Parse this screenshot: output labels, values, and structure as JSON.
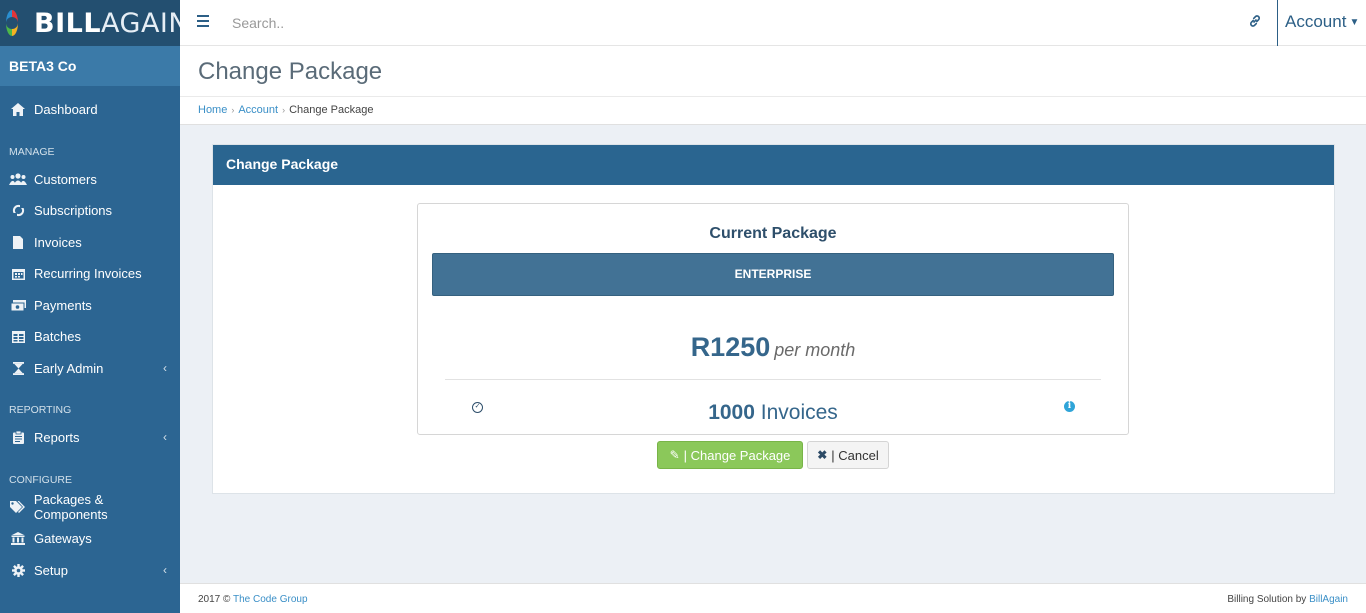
{
  "brand": {
    "name_part1": "BILL",
    "name_part2": "AGAIN"
  },
  "company": "BETA3 Co",
  "sidebar": {
    "items": [
      {
        "label": "Dashboard",
        "icon": "home-icon"
      },
      {
        "label": "Customers",
        "icon": "users-icon"
      },
      {
        "label": "Subscriptions",
        "icon": "refresh-icon"
      },
      {
        "label": "Invoices",
        "icon": "file-icon"
      },
      {
        "label": "Recurring Invoices",
        "icon": "calendar-icon"
      },
      {
        "label": "Payments",
        "icon": "money-icon"
      },
      {
        "label": "Batches",
        "icon": "table-icon"
      },
      {
        "label": "Early Admin",
        "icon": "hourglass-icon"
      },
      {
        "label": "Reports",
        "icon": "clipboard-icon"
      },
      {
        "label": "Packages & Components",
        "icon": "tags-icon"
      },
      {
        "label": "Gateways",
        "icon": "bank-icon"
      },
      {
        "label": "Setup",
        "icon": "gear-icon"
      }
    ],
    "sections": {
      "manage": "MANAGE",
      "reporting": "REPORTING",
      "configure": "CONFIGURE"
    }
  },
  "topbar": {
    "search_placeholder": "Search..",
    "account_label": "Account"
  },
  "page": {
    "title": "Change Package",
    "breadcrumb": [
      "Home",
      "Account",
      "Change Package"
    ]
  },
  "panel": {
    "title": "Change Package",
    "card_title": "Current Package",
    "package_name": "ENTERPRISE",
    "price_amount": "R1250",
    "price_period": "per month",
    "feature_count": "1000",
    "feature_unit": "Invoices"
  },
  "buttons": {
    "change": "| Change Package",
    "cancel": "| Cancel"
  },
  "footer": {
    "left_prefix": "2017 ©",
    "left_link": "The Code Group",
    "right_prefix": "Billing Solution by",
    "right_link": "BillAgain"
  },
  "colors": {
    "sidebar": "#2c6592",
    "panel_header": "#2a6590",
    "banner": "#427295",
    "primary_button": "#8bc85a",
    "link": "#3a8fc7"
  }
}
